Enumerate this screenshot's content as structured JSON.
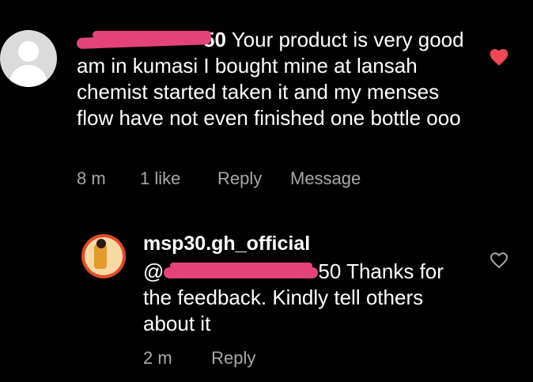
{
  "comment": {
    "username_suffix": "50",
    "text": "Your product is very good am in kumasi I bought mine at lansah chemist started taken it and my menses flow have not even finished one bottle ooo",
    "time": "8 m",
    "likes": "1 like",
    "reply_label": "Reply",
    "message_label": "Message",
    "liked": true
  },
  "reply": {
    "username": "msp30.gh_official",
    "mention_prefix": "@",
    "mention_suffix": "50",
    "text": "Thanks for the feedback. Kindly tell others about it",
    "time": "2 m",
    "reply_label": "Reply",
    "liked": false
  },
  "colors": {
    "background": "#000000",
    "text": "#ffffff",
    "muted": "#a8a8a8",
    "like_red": "#ed4956",
    "redaction": "#e4437a"
  }
}
